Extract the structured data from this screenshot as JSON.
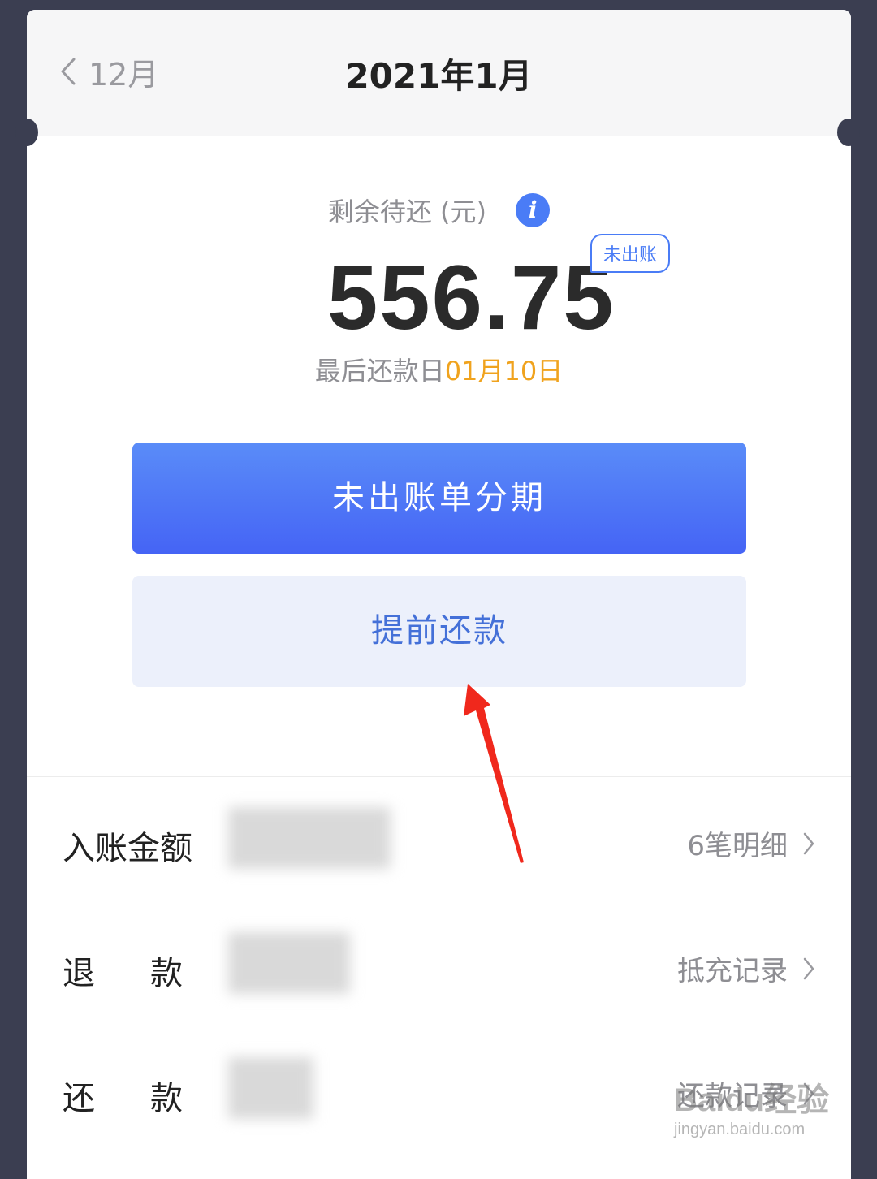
{
  "header": {
    "prev_label": "12月",
    "title": "2021年1月"
  },
  "balance": {
    "label": "剩余待还 (元)",
    "info_icon": "info-icon",
    "amount": "556.75",
    "status_badge": "未出账",
    "due_prefix": "最后还款日",
    "due_date": "01月10日"
  },
  "actions": {
    "primary_label": "未出账单分期",
    "secondary_label": "提前还款"
  },
  "details": [
    {
      "label": "入账金额",
      "link": "6笔明细"
    },
    {
      "label": "退款",
      "link": "抵充记录"
    },
    {
      "label": "还款",
      "link": "还款记录"
    }
  ],
  "colors": {
    "accent": "#4a7cf6",
    "due_date": "#f0a31e",
    "primary_button": "#4564f5",
    "secondary_button_bg": "#ecf0fb",
    "annotation_arrow": "#f0281c"
  },
  "watermark": {
    "top": "Baidu经验",
    "bottom": "jingyan.baidu.com"
  }
}
